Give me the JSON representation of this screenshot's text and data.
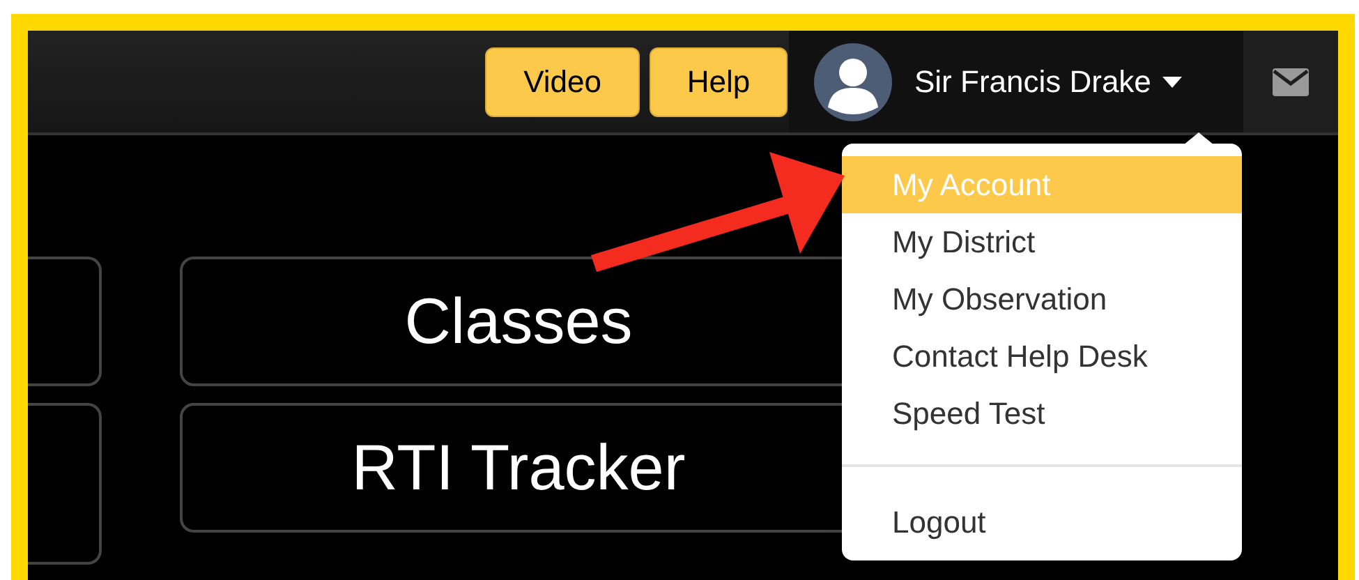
{
  "header": {
    "buttons": [
      {
        "label": "Video"
      },
      {
        "label": "Help"
      }
    ],
    "user": {
      "name": "Sir Francis Drake"
    }
  },
  "tiles": [
    {
      "label": "Classes"
    },
    {
      "label": "RTI Tracker"
    }
  ],
  "user_menu": {
    "items": [
      {
        "label": "My Account",
        "selected": true,
        "divider_before": false
      },
      {
        "label": "My District",
        "selected": false,
        "divider_before": false
      },
      {
        "label": "My Observation",
        "selected": false,
        "divider_before": false
      },
      {
        "label": "Contact Help Desk",
        "selected": false,
        "divider_before": false
      },
      {
        "label": "Speed Test",
        "selected": false,
        "divider_before": false
      },
      {
        "label": "Logout",
        "selected": false,
        "divider_before": true
      }
    ]
  }
}
